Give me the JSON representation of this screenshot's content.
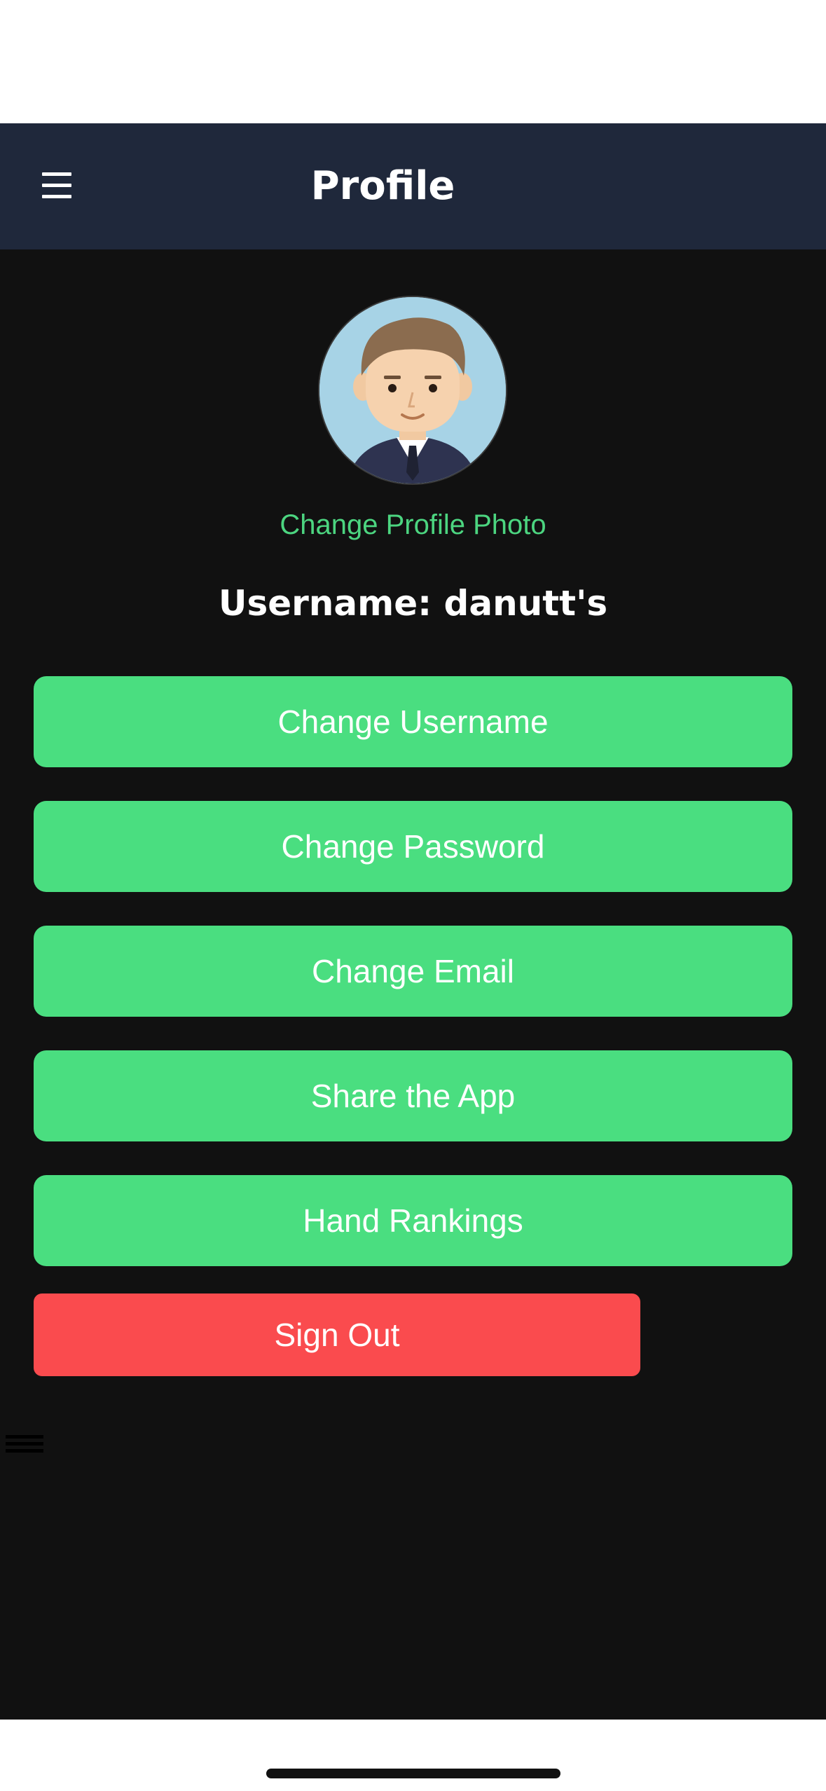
{
  "header": {
    "title": "Profile",
    "menu_icon": "hamburger-menu-icon",
    "background_color": "#1f283b"
  },
  "profile": {
    "avatar_icon": "person-avatar-illustration",
    "change_photo_label": "Change Profile Photo",
    "username_label": "Username: danutt's"
  },
  "actions": [
    {
      "label": "Change Username"
    },
    {
      "label": "Change Password"
    },
    {
      "label": "Change Email"
    },
    {
      "label": "Share the App"
    },
    {
      "label": "Hand Rankings"
    }
  ],
  "sign_out": {
    "label": "Sign Out",
    "color": "#fa4b4e"
  },
  "colors": {
    "accent": "#4ade80",
    "accent_text": "#4cd580",
    "content_background": "#111111"
  },
  "drag_handle_icon": "drag-handle-icon"
}
